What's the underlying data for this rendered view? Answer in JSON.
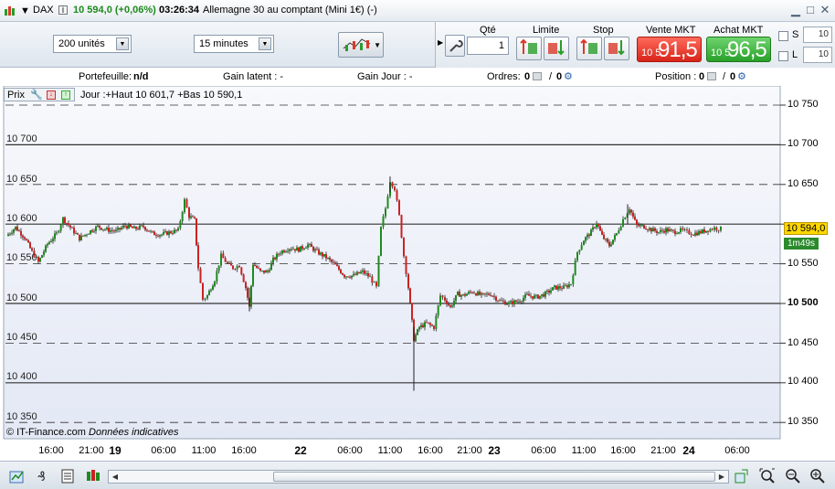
{
  "titlebar": {
    "symbol": "DAX",
    "price_change": "10 594,0 (+0,06%)",
    "time": "03:26:34",
    "instrument": "Allemagne 30 au comptant (Mini 1€) (-)",
    "info": "i"
  },
  "toolbar": {
    "units_select": "200 unités",
    "interval_select": "15 minutes",
    "qty_label": "Qté",
    "qty_value": "1",
    "limit_label": "Limite",
    "stop_label": "Stop",
    "sell_label": "Vente MKT",
    "sell_prefix": "10 5",
    "sell_big": "91,5",
    "buy_label": "Achat MKT",
    "buy_prefix": "10 5",
    "buy_big": "96,5",
    "s_label": "S",
    "s_value": "10",
    "l_label": "L",
    "l_value": "10"
  },
  "status": {
    "portefeuille_label": "Portefeuille:",
    "portefeuille_value": "n/d",
    "gain_latent": "Gain latent :  -",
    "gain_jour": "Gain Jour :  -",
    "ordres_label": "Ordres:",
    "ordres_a": "0",
    "ordres_sep": "/",
    "ordres_b": "0",
    "position_label": "Position :",
    "position_a": "0",
    "position_sep": "/",
    "position_b": "0"
  },
  "chart": {
    "toolbar_label": "Prix",
    "jour_text": "Jour :+Haut 10 601,7 +Bas 10 590,1",
    "y_ticks": [
      "10 750",
      "10 700",
      "10 650",
      "10 600",
      "10 550",
      "10 500",
      "10 450",
      "10 400",
      "10 350"
    ],
    "y_left_labels": [
      "10 700",
      "10 650",
      "10 600",
      "10 550",
      "10 500",
      "10 450",
      "10 400",
      "10 350"
    ],
    "current_price": "10 594,0",
    "timer": "1m49s",
    "watermark": "© IT-Finance.com",
    "watermark_note": "Données indicatives",
    "x_labels": [
      "16:00",
      "21:00",
      "19",
      "06:00",
      "11:00",
      "16:00",
      "22",
      "06:00",
      "11:00",
      "16:00",
      "21:00",
      "23",
      "06:00",
      "11:00",
      "16:00",
      "21:00",
      "24",
      "06:00"
    ],
    "colors": {
      "up": "#1e8b1e",
      "down": "#cc2222",
      "grid": "#333333",
      "bg_top": "#f8f9fc",
      "bg_bottom": "#e3e8f5"
    }
  },
  "chart_data": {
    "type": "candlestick",
    "ylim": [
      10340,
      10760
    ],
    "y_ticks": [
      10350,
      10400,
      10450,
      10500,
      10550,
      10600,
      10650,
      10700,
      10750
    ],
    "current": 10594.0,
    "day_high": 10601.7,
    "day_low": 10590.1,
    "path": [
      [
        0,
        10585
      ],
      [
        10,
        10596
      ],
      [
        20,
        10583
      ],
      [
        28,
        10565
      ],
      [
        35,
        10552
      ],
      [
        45,
        10575
      ],
      [
        55,
        10588
      ],
      [
        62,
        10607
      ],
      [
        70,
        10596
      ],
      [
        80,
        10582
      ],
      [
        90,
        10590
      ],
      [
        100,
        10597
      ],
      [
        110,
        10593
      ],
      [
        120,
        10591
      ],
      [
        130,
        10598
      ],
      [
        140,
        10594
      ],
      [
        150,
        10597
      ],
      [
        160,
        10588
      ],
      [
        170,
        10587
      ],
      [
        180,
        10590
      ],
      [
        188,
        10592
      ],
      [
        195,
        10630
      ],
      [
        200,
        10610
      ],
      [
        206,
        10605
      ],
      [
        210,
        10545
      ],
      [
        215,
        10505
      ],
      [
        220,
        10510
      ],
      [
        228,
        10530
      ],
      [
        235,
        10560
      ],
      [
        242,
        10550
      ],
      [
        248,
        10545
      ],
      [
        255,
        10548
      ],
      [
        262,
        10520
      ],
      [
        266,
        10495
      ],
      [
        270,
        10550
      ],
      [
        278,
        10540
      ],
      [
        286,
        10540
      ],
      [
        292,
        10555
      ],
      [
        300,
        10565
      ],
      [
        310,
        10570
      ],
      [
        320,
        10568
      ],
      [
        330,
        10574
      ],
      [
        340,
        10565
      ],
      [
        350,
        10558
      ],
      [
        360,
        10548
      ],
      [
        370,
        10535
      ],
      [
        380,
        10535
      ],
      [
        390,
        10540
      ],
      [
        398,
        10533
      ],
      [
        405,
        10520
      ],
      [
        410,
        10595
      ],
      [
        415,
        10620
      ],
      [
        420,
        10655
      ],
      [
        425,
        10645
      ],
      [
        430,
        10610
      ],
      [
        435,
        10560
      ],
      [
        440,
        10520
      ],
      [
        446,
        10455
      ],
      [
        452,
        10470
      ],
      [
        460,
        10475
      ],
      [
        468,
        10470
      ],
      [
        475,
        10510
      ],
      [
        480,
        10505
      ],
      [
        486,
        10495
      ],
      [
        494,
        10512
      ],
      [
        500,
        10510
      ],
      [
        510,
        10515
      ],
      [
        520,
        10510
      ],
      [
        530,
        10512
      ],
      [
        540,
        10503
      ],
      [
        550,
        10500
      ],
      [
        560,
        10503
      ],
      [
        570,
        10510
      ],
      [
        580,
        10508
      ],
      [
        590,
        10512
      ],
      [
        600,
        10520
      ],
      [
        610,
        10520
      ],
      [
        618,
        10525
      ],
      [
        625,
        10565
      ],
      [
        632,
        10580
      ],
      [
        640,
        10590
      ],
      [
        646,
        10602
      ],
      [
        652,
        10585
      ],
      [
        660,
        10573
      ],
      [
        668,
        10588
      ],
      [
        675,
        10606
      ],
      [
        682,
        10620
      ],
      [
        690,
        10598
      ],
      [
        698,
        10597
      ],
      [
        706,
        10593
      ],
      [
        714,
        10590
      ],
      [
        722,
        10593
      ],
      [
        730,
        10590
      ],
      [
        738,
        10592
      ],
      [
        745,
        10590
      ],
      [
        752,
        10588
      ],
      [
        760,
        10590
      ],
      [
        768,
        10593
      ],
      [
        775,
        10595
      ],
      [
        782,
        10594
      ]
    ],
    "spikes": [
      [
        446,
        10390,
        10470
      ],
      [
        420,
        10660,
        10640
      ],
      [
        680,
        10625,
        10600
      ],
      [
        266,
        10490,
        10520
      ]
    ]
  }
}
